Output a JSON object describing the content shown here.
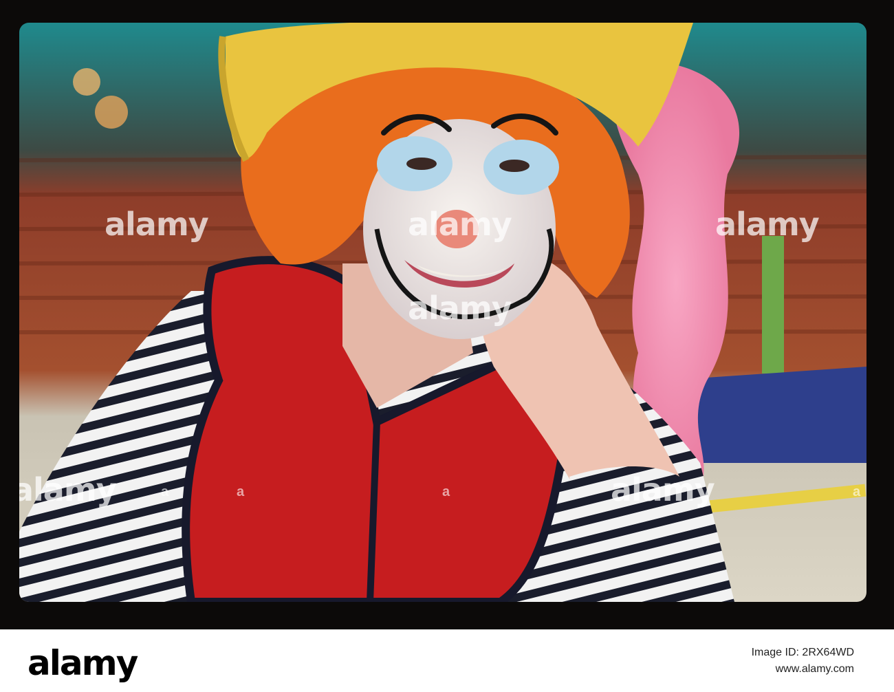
{
  "watermark": {
    "text": "alamy",
    "mark": "a"
  },
  "footer": {
    "logo_text": "alamy",
    "image_id_line": "Image ID: 2RX64WD",
    "site_line": "www.alamy.com"
  },
  "colors": {
    "film_border": "#0c0a09",
    "hat": "#e9c43f",
    "hair": "#e96d1d",
    "vest": "#c61d1f",
    "feather": "#f18ab0",
    "arena_seats": "#a24a2d"
  },
  "icons": [
    "alamy-logo"
  ]
}
